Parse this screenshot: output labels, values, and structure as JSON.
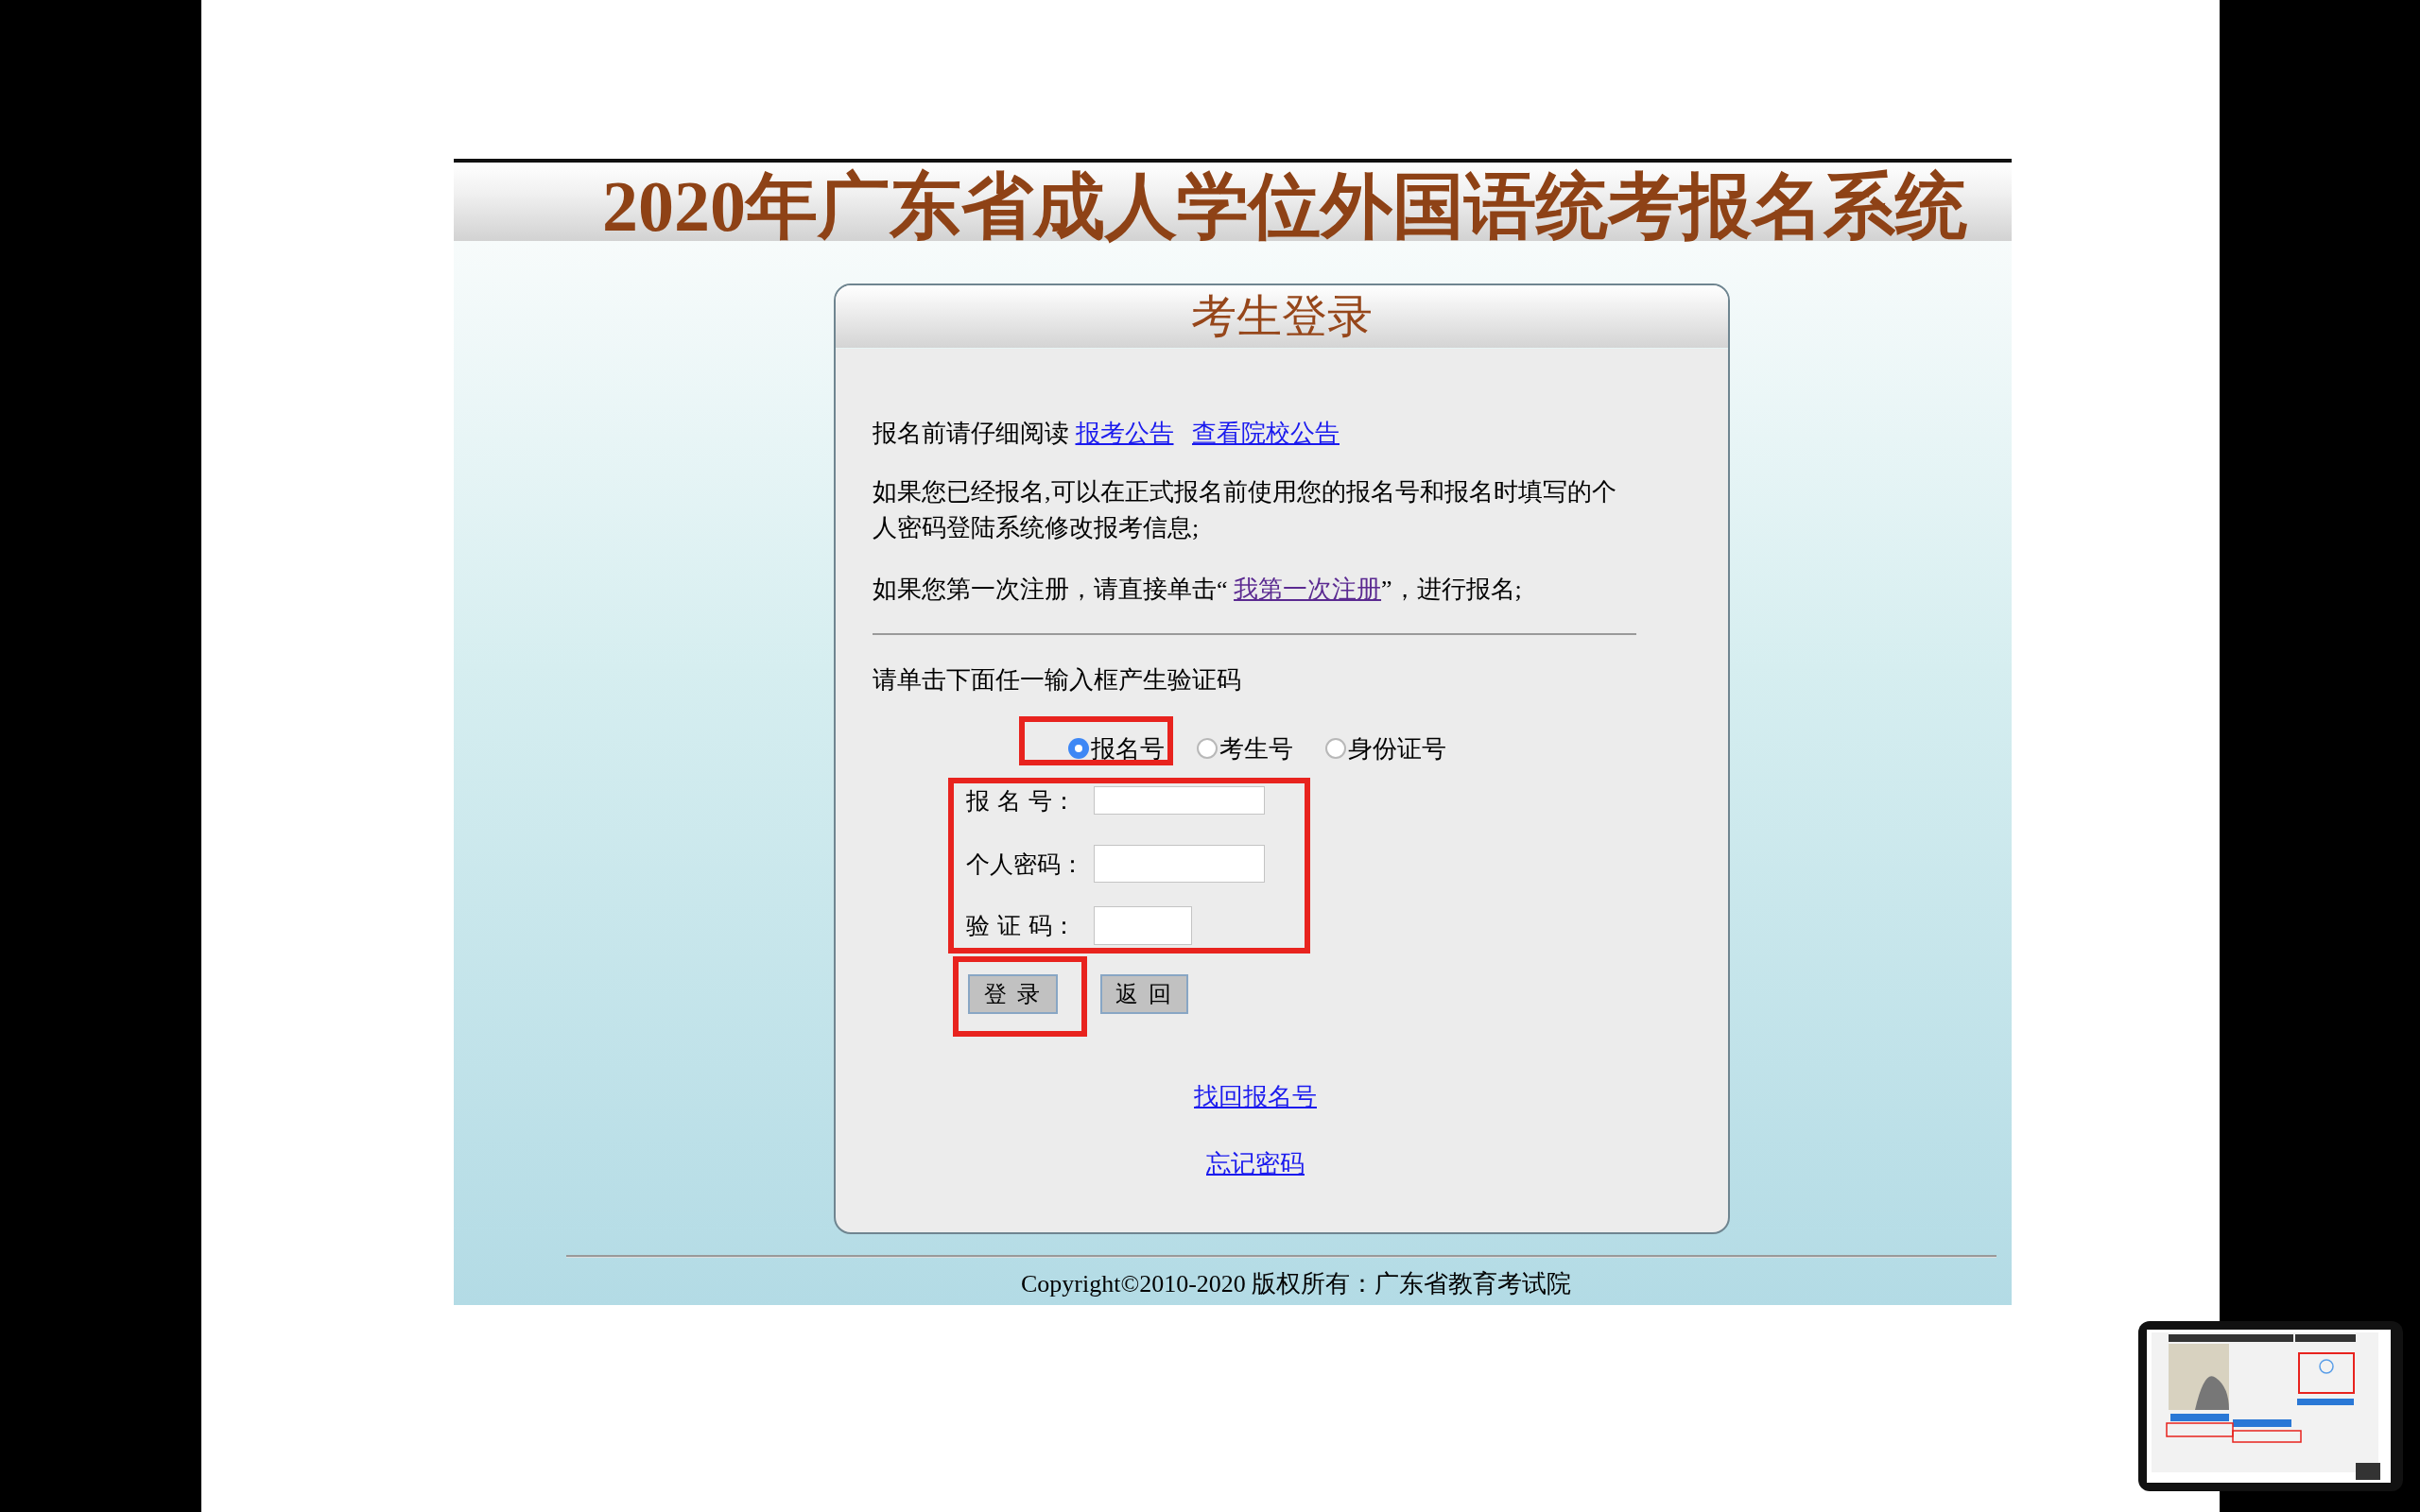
{
  "header": {
    "title": "2020年广东省成人学位外国语统考报名系统"
  },
  "login": {
    "title": "考生登录",
    "notice": {
      "text": "报名前请仔细阅读",
      "links": [
        {
          "text": "报考公告",
          "visited": false
        },
        {
          "text": "查看院校公告",
          "visited": false
        }
      ]
    },
    "info": "如果您已经报名,可以在正式报名前使用您的报名号和报名时填写的个人密码登陆系统修改报考信息;",
    "register": {
      "before": "如果您第一次注册，请直接单击“",
      "link": {
        "text": "我第一次注册",
        "visited": true
      },
      "after": "”，进行报名;"
    },
    "prompt": "请单击下面任一输入框产生验证码",
    "id_types": [
      {
        "label": "报名号",
        "selected": true
      },
      {
        "label": "考生号",
        "selected": false
      },
      {
        "label": "身份证号",
        "selected": false
      }
    ],
    "fields": [
      {
        "label": "报 名 号：",
        "kind": "long"
      },
      {
        "label": "个人密码：",
        "kind": "long"
      },
      {
        "label": "验 证 码：",
        "kind": "short"
      }
    ],
    "buttons": [
      "登 录",
      "返 回"
    ],
    "links": [
      {
        "text": "找回报名号"
      },
      {
        "text": "忘记密码"
      }
    ]
  },
  "highlights": [
    {
      "kind": "id-type"
    },
    {
      "kind": "fields"
    },
    {
      "kind": "login-button"
    }
  ],
  "footer": {
    "copyright": "Copyright©2010-2020 版权所有：广东省教育考试院"
  }
}
